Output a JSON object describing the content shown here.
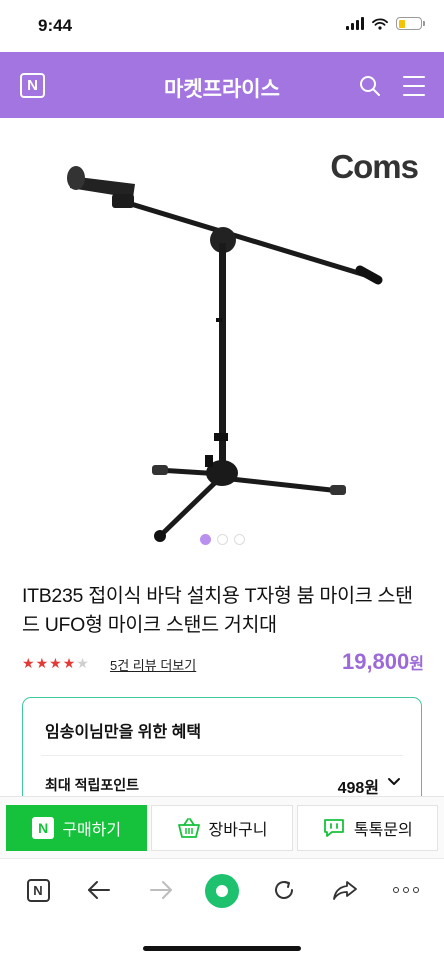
{
  "status_bar": {
    "time": "9:44"
  },
  "header": {
    "logo": "N",
    "title": "마켓프라이스"
  },
  "product": {
    "brand_logo": "Coms",
    "title": "ITB235 접이식 바닥 설치용 T자형 붐 마이크 스탠드 UFO형 마이크 스탠드 거치대",
    "rating": 4,
    "rating_max": 5,
    "review_link": "5건 리뷰 더보기",
    "price": "19,800",
    "price_unit": "원",
    "image_count": 3,
    "current_image": 1
  },
  "benefit": {
    "title": "임송이님만을 위한 혜택",
    "points_label": "최대 적립포인트",
    "points_value": "498원"
  },
  "actions": {
    "buy_badge": "N",
    "buy_label": "구매하기",
    "cart_label": "장바구니",
    "talk_label": "톡톡문의"
  },
  "browser": {
    "home_logo": "N"
  },
  "colors": {
    "header": "#a275e0",
    "price": "#9b6ad8",
    "buy": "#16c23c",
    "card_border": "#3ec9a0",
    "stars": "#e53935"
  },
  "icons": [
    "n-logo-icon",
    "search-icon",
    "menu-icon",
    "chevron-down-icon",
    "basket-icon",
    "chat-icon",
    "back-icon",
    "forward-icon",
    "reload-icon",
    "share-icon",
    "more-icon"
  ]
}
